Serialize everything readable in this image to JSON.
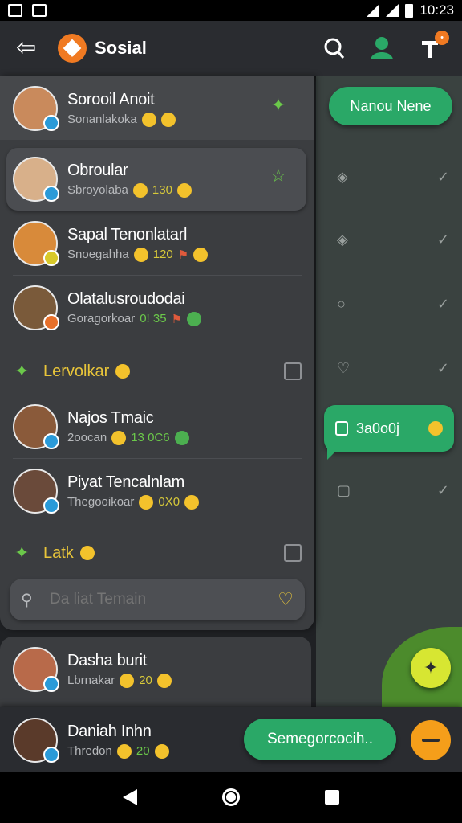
{
  "status_bar": {
    "time": "10:23"
  },
  "app_bar": {
    "title": "Sosial"
  },
  "right_panel": {
    "name_pill": "Nanou Nene",
    "message_bubble": "3a0o0j"
  },
  "chats": [
    {
      "name": "Sorooil Anoit",
      "sub": "Sonanlakoka",
      "color": "#c98a5c",
      "dot": "#2a9ad8"
    },
    {
      "name": "Obroular",
      "sub": "Sbroyolaba",
      "num": "130",
      "num_class": "num-y",
      "color": "#d8b08a",
      "dot": "#2a9ad8"
    },
    {
      "name": "Sapal Tenonlatarl",
      "sub": "Snoegahha",
      "num": "120",
      "num_class": "num-y",
      "color": "#d88a3a",
      "dot": "#d8c92a"
    },
    {
      "name": "Olatalusroudodai",
      "sub": "Goragorkoar",
      "num": "0! 35",
      "num_class": "num-g",
      "color": "#7a5a3a",
      "dot": "#e8702a"
    },
    {
      "name": "Najos Tmaic",
      "sub": "2oocan",
      "num": "13 0C6",
      "num_class": "num-g",
      "color": "#8a5a3a",
      "dot": "#2a9ad8"
    },
    {
      "name": "Piyat Tencalnlam",
      "sub": "Thegooikoar",
      "num": "0X0",
      "num_class": "num-y",
      "color": "#6a4a3a",
      "dot": "#2a9ad8"
    },
    {
      "name": "Dasha burit",
      "sub": "Lbrnakar",
      "num": "20",
      "num_class": "num-y",
      "color": "#b86a4a",
      "dot": "#2a9ad8"
    },
    {
      "name": "Daniah Inhn",
      "sub": "Thredon",
      "num": "20",
      "num_class": "num-g",
      "color": "#5a3a2a",
      "dot": "#2a9ad8"
    }
  ],
  "sections": [
    {
      "label": "Lervolkar"
    },
    {
      "label": "Latk"
    }
  ],
  "search": {
    "placeholder": "Da liat Temain"
  },
  "send_button": {
    "label": "Semegorcocih.."
  },
  "colors": {
    "accent_green": "#2aa867",
    "accent_orange": "#f07a22",
    "accent_lime": "#d7e632",
    "section_yellow": "#e8c53a"
  }
}
